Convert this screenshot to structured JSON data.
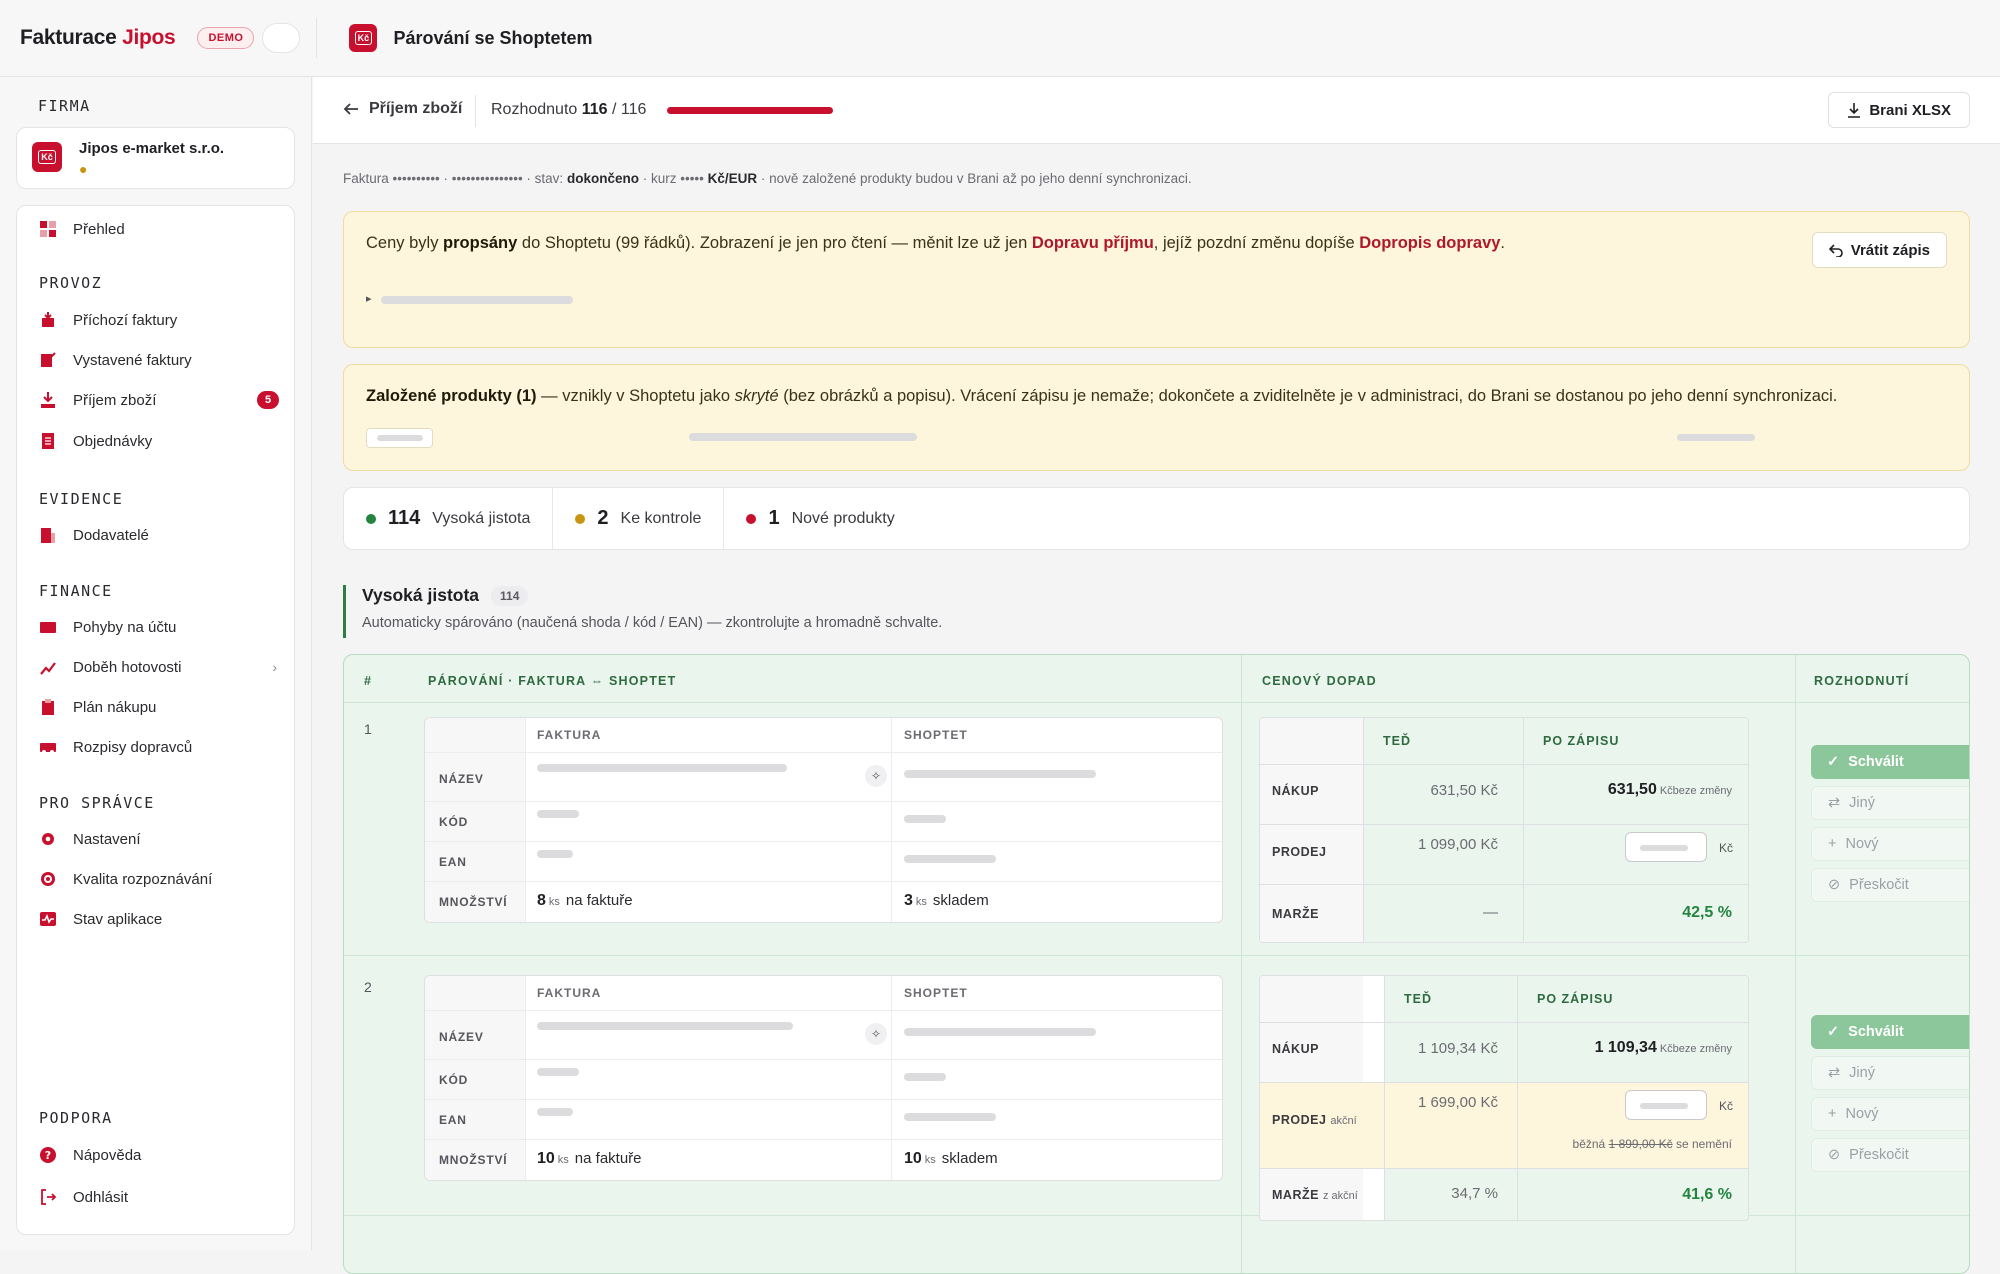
{
  "app": {
    "brand_main": "Fakturace",
    "brand_accent": "Jipos",
    "demo": "DEMO",
    "page_title": "Párování se Shoptetem",
    "kc_icon_text": "Kč"
  },
  "firm": {
    "section": "FIRMA",
    "name": "Jipos e-market s.r.o."
  },
  "nav": {
    "overview": "Přehled",
    "provoz": "PROVOZ",
    "prichozi": "Příchozí faktury",
    "vystavene": "Vystavené faktury",
    "prijem": "Příjem zboží",
    "prijem_badge": "5",
    "objednavky": "Objednávky",
    "evidence": "EVIDENCE",
    "dodavatele": "Dodavatelé",
    "finance": "FINANCE",
    "pohyby": "Pohyby na účtu",
    "dobeh": "Doběh hotovosti",
    "plan": "Plán nákupu",
    "rozpisy": "Rozpisy dopravců",
    "pro_spravce": "PRO SPRÁVCE",
    "nastaveni": "Nastavení",
    "kvalita": "Kvalita rozpoznávání",
    "stav": "Stav aplikace",
    "podpora": "PODPORA",
    "napoveda": "Nápověda",
    "odhlasit": "Odhlásit"
  },
  "subbar": {
    "back": "Příjem zboží",
    "decided_label": "Rozhodnuto",
    "decided": "116",
    "total": "/ 116",
    "progress": 1.0,
    "export": "Brani XLSX"
  },
  "meta": {
    "prefix": "Faktura •••••••••• · ••••••••••••••• · stav:",
    "state": "dokončeno",
    "kurz_label": "· kurz ••••• ",
    "kurz": "Kč/EUR",
    "suffix": "· nově založené produkty budou v Brani až po jeho denní synchronizaci."
  },
  "alert1": {
    "t1": "Ceny byly ",
    "b1": "propsány",
    "t2": " do Shoptetu (99 řádků). Zobrazení je jen pro čtení — měnit lze už jen ",
    "r1": "Dopravu příjmu",
    "t3": ", jejíž pozdní změnu dopíše ",
    "r2": "Dopropis dopravy",
    "t4": ".",
    "undo": "Vrátit zápis",
    "toggle": "▸"
  },
  "alert2": {
    "b1": "Založené produkty (1)",
    "t1": " — vznikly v Shoptetu jako ",
    "i1": "skryté",
    "t2": " (bez obrázků a popisu). Vrácení zápisu je nemaže; dokončete a zviditelněte je v administraci, do Brani se dostanou po jeho denní synchronizaci."
  },
  "stats": [
    {
      "count": "114",
      "label": "Vysoká jistota",
      "color": "#23843f"
    },
    {
      "count": "2",
      "label": "Ke kontrole",
      "color": "#c89411"
    },
    {
      "count": "1",
      "label": "Nové produkty",
      "color": "#c8102e"
    }
  ],
  "group": {
    "title": "Vysoká jistota",
    "count": "114",
    "subtitle": "Automaticky spárováno (naučená shoda / kód / EAN) — zkontrolujte a hromadně schvalte."
  },
  "table_headers": {
    "num": "#",
    "pairing": "PÁROVÁNÍ · FAKTURA ⇔ SHOPTET",
    "price": "CENOVÝ DOPAD",
    "decision": "ROZHODNUTÍ"
  },
  "match_labels": {
    "faktura": "FAKTURA",
    "shoptet": "SHOPTET",
    "nazev": "NÁZEV",
    "kod": "KÓD",
    "ean": "EAN",
    "mnozstvi": "MNOŽSTVÍ",
    "ks": "ks",
    "na_fakture": "na faktuře",
    "skladem": "skladem"
  },
  "price_labels": {
    "ted": "TEĎ",
    "po_zapisu": "PO ZÁPISU",
    "nakup": "NÁKUP",
    "prodej": "PRODEJ",
    "marze": "MARŽE",
    "akcni": "akční",
    "z_akcni": "z akční",
    "kc": "Kč",
    "beze_zmeny": "Kčbeze změny"
  },
  "buttons": {
    "approve": "Schválit",
    "other": "Jiný",
    "new": "Nový",
    "skip": "Přeskočit"
  },
  "rows": [
    {
      "num": "1",
      "qty_invoice": "8",
      "qty_stock": "3",
      "nakup_ted": "631,50 Kč",
      "nakup_po": "631,50",
      "prodej_ted": "1 099,00 Kč",
      "marze_ted": "—",
      "marze_po": "42,5 %"
    },
    {
      "num": "2",
      "qty_invoice": "10",
      "qty_stock": "10",
      "nakup_ted": "1 109,34 Kč",
      "nakup_po": "1 109,34",
      "prodej_ted": "1 699,00 Kč",
      "bezna_prefix": "běžná ",
      "bezna_price": "1 899,00 Kč",
      "bezna_suffix": " se nemění",
      "marze_ted": "34,7 %",
      "marze_po": "41,6 %"
    }
  ]
}
